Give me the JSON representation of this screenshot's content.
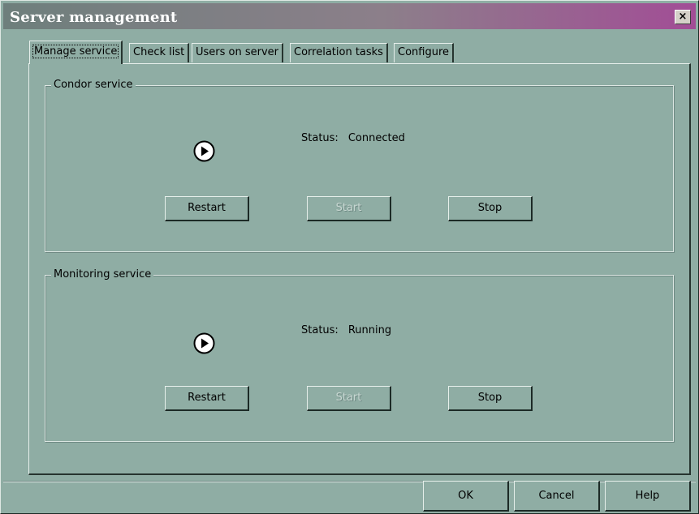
{
  "window": {
    "title": "Server management",
    "close_glyph": "×"
  },
  "tabs": [
    {
      "label": "Manage service",
      "active": true
    },
    {
      "label": "Check list",
      "active": false
    },
    {
      "label": "Users on server",
      "active": false
    },
    {
      "label": "Correlation tasks",
      "active": false
    },
    {
      "label": "Configure",
      "active": false
    }
  ],
  "services": [
    {
      "title": "Condor service",
      "status_label": "Status:",
      "status_value": "Connected",
      "icon": "play-circle-icon",
      "buttons": {
        "restart": "Restart",
        "start": "Start",
        "stop": "Stop"
      },
      "start_enabled": false
    },
    {
      "title": "Monitoring service",
      "status_label": "Status:",
      "status_value": "Running",
      "icon": "play-circle-icon",
      "buttons": {
        "restart": "Restart",
        "start": "Start",
        "stop": "Stop"
      },
      "start_enabled": false
    }
  ],
  "footer": {
    "ok": "OK",
    "cancel": "Cancel",
    "help": "Help"
  },
  "colors": {
    "background": "#8fada4",
    "title_gradient_start": "#6e7f7c",
    "title_gradient_end": "#a24d96"
  }
}
